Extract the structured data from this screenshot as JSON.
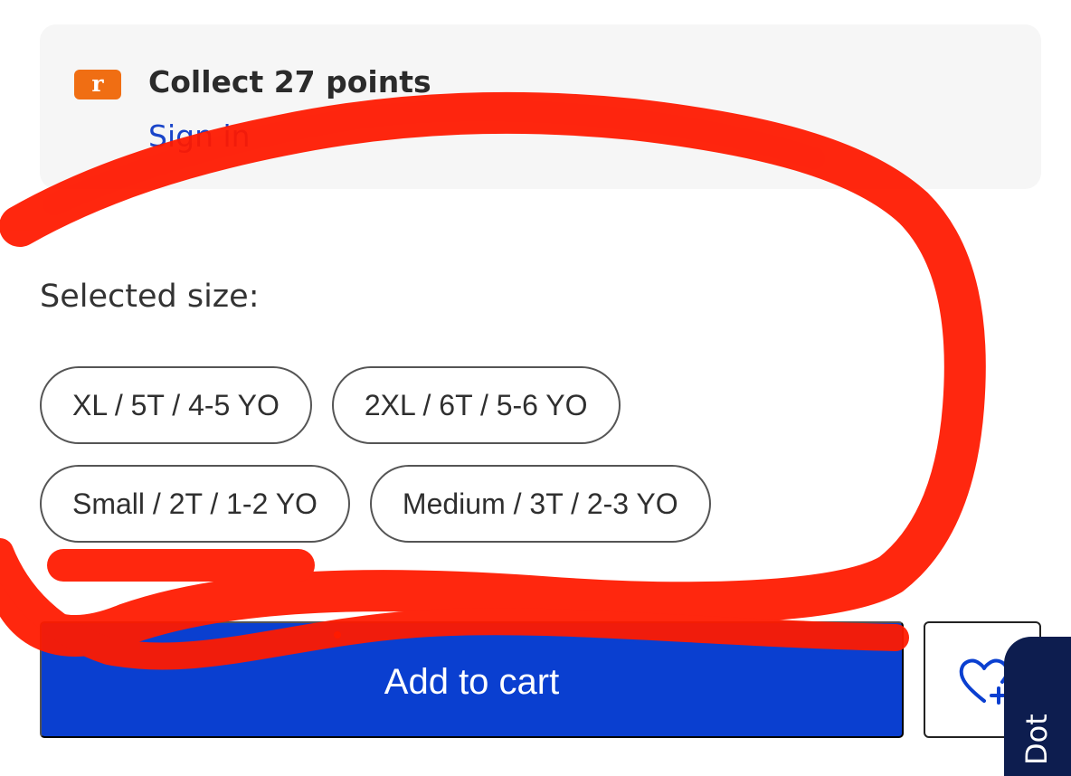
{
  "rewards": {
    "badge_letter": "r",
    "title": "Collect 27 points",
    "signin_label": "Sign in",
    "badge_color": "#f06e13",
    "link_color": "#1a45c9"
  },
  "size_selector": {
    "label": "Selected size:",
    "options": [
      "XL / 5T / 4-5 YO",
      "2XL / 6T / 5-6 YO",
      "Small / 2T / 1-2 YO",
      "Medium / 3T / 2-3 YO"
    ]
  },
  "actions": {
    "add_to_cart_label": "Add to cart",
    "wishlist_icon": "heart-plus-icon",
    "primary_color": "#0a3fd0"
  },
  "side_tab": {
    "label": "Dot"
  },
  "annotation": {
    "color": "#ff1a00",
    "shape": "hand-drawn ellipse around size options"
  }
}
